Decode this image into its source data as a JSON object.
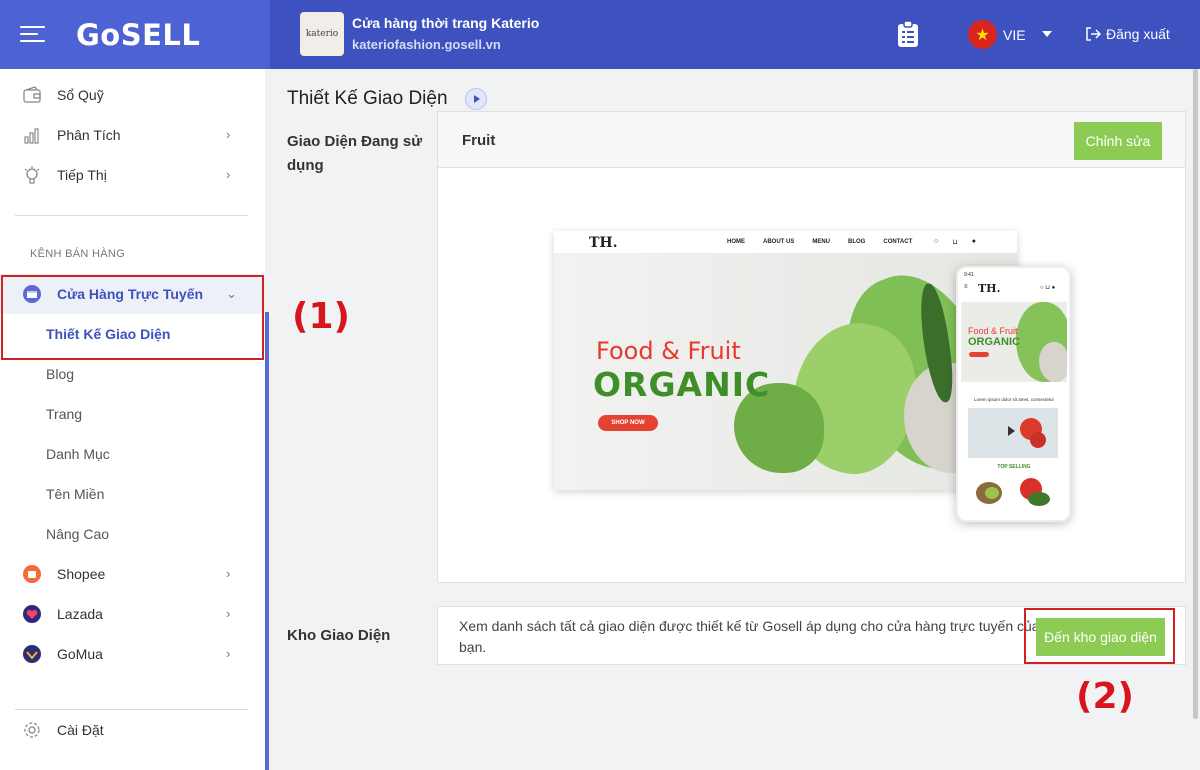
{
  "header": {
    "brand": "GoSELL",
    "store_logo_text": "katerio",
    "store_name": "Cửa hàng thời trang Katerio",
    "store_url": "kateriofashion.gosell.vn",
    "language": "VIE",
    "logout_label": "Đăng xuất",
    "accent_color": "#3d51bf"
  },
  "sidebar": {
    "items_top": [
      {
        "label": "Sổ Quỹ",
        "icon": "wallet-icon"
      },
      {
        "label": "Phân Tích",
        "icon": "chart-icon"
      },
      {
        "label": "Tiếp Thị",
        "icon": "lightbulb-icon"
      }
    ],
    "section_label": "KÊNH BÁN HÀNG",
    "online_store": {
      "label": "Cửa Hàng Trực Tuyến",
      "sub_items": [
        "Thiết Kế Giao Diện",
        "Blog",
        "Trang",
        "Danh Mục",
        "Tên Miền",
        "Nâng Cao"
      ]
    },
    "channels": [
      {
        "label": "Shopee",
        "icon": "shopee-icon"
      },
      {
        "label": "Lazada",
        "icon": "lazada-icon"
      },
      {
        "label": "GoMua",
        "icon": "gomua-icon"
      }
    ],
    "settings_label": "Cài Đặt"
  },
  "annotations": {
    "one": "(1)",
    "two": "(2)"
  },
  "main": {
    "page_title": "Thiết Kế Giao Diện",
    "current_theme_label": "Giao Diện Đang sử dụng",
    "theme_name": "Fruit",
    "edit_label": "Chỉnh sửa",
    "preview": {
      "logo": "TH.",
      "menu": [
        "HOME",
        "ABOUT US",
        "MENU",
        "BLOG",
        "CONTACT"
      ],
      "hero_line1": "Food & Fruit",
      "hero_line2": "ORGANIC",
      "hero_button": "SHOP NOW",
      "phone_time": "9:41",
      "phone_caption": "Lorem ipsum dolor sit amet, consectetur",
      "phone_section": "TOP SELLING"
    },
    "store_label": "Kho Giao Diện",
    "store_desc": "Xem danh sách tất cả giao diện được thiết kế từ Gosell áp dụng cho cửa hàng trực tuyến của bạn.",
    "goto_label": "Đến kho giao diện"
  }
}
